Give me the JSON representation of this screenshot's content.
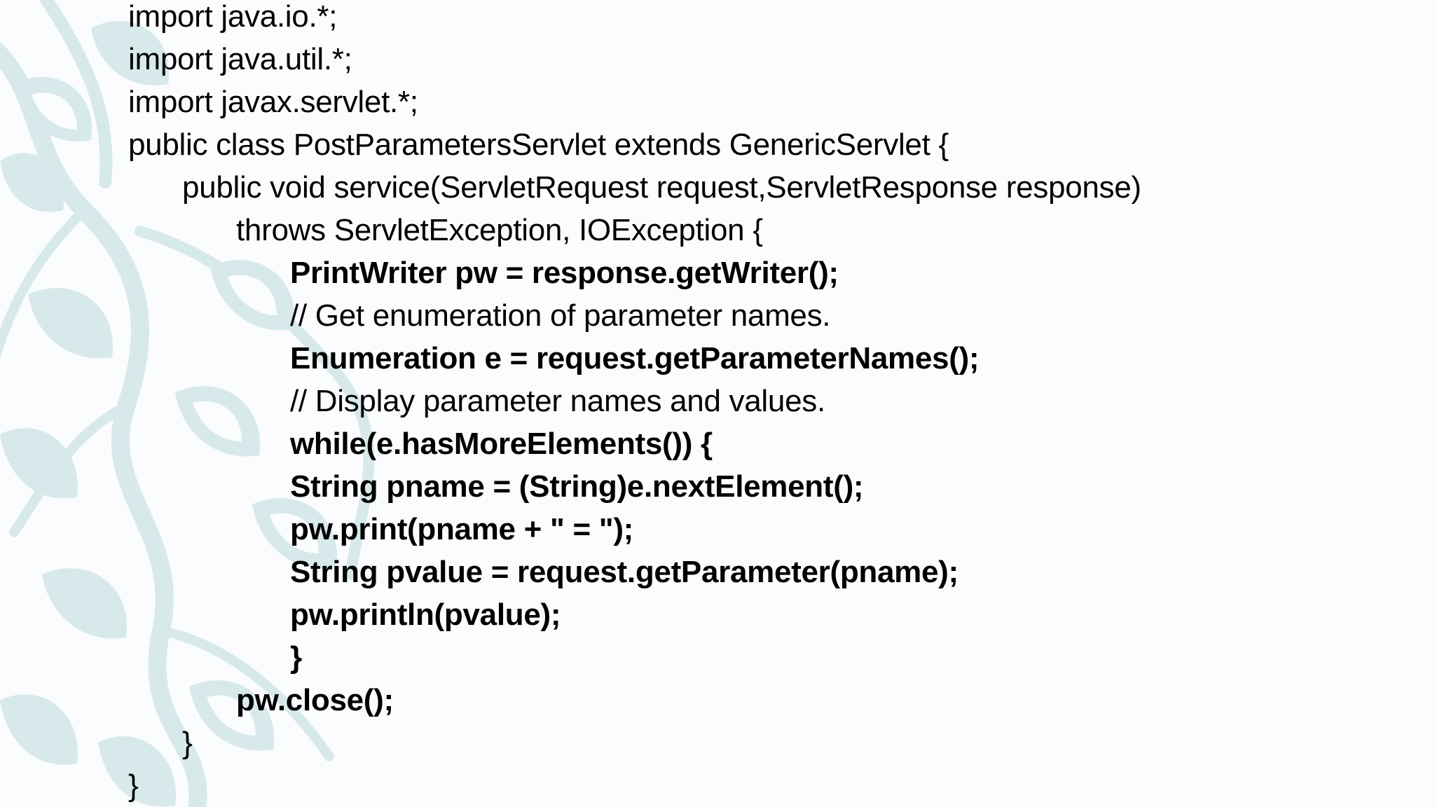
{
  "slide": {
    "background_color": "#fbfcfe",
    "ornament_color": "#d7e9ea",
    "ornament": "leaf-vine-ornament"
  },
  "code": {
    "lines": [
      "import java.io.*;",
      "import java.util.*;",
      "import javax.servlet.*;",
      "public class PostParametersServlet extends GenericServlet {",
      "public void service(ServletRequest request,ServletResponse response)",
      "throws ServletException, IOException {",
      "PrintWriter pw = response.getWriter();",
      "// Get enumeration of parameter names.",
      "Enumeration e = request.getParameterNames();",
      "// Display parameter names and values.",
      "while(e.hasMoreElements()) {",
      "String pname = (String)e.nextElement();",
      "pw.print(pname + \" = \");",
      "String pvalue = request.getParameter(pname);",
      "pw.println(pvalue);",
      "}",
      "pw.close();",
      "}",
      "}"
    ]
  }
}
